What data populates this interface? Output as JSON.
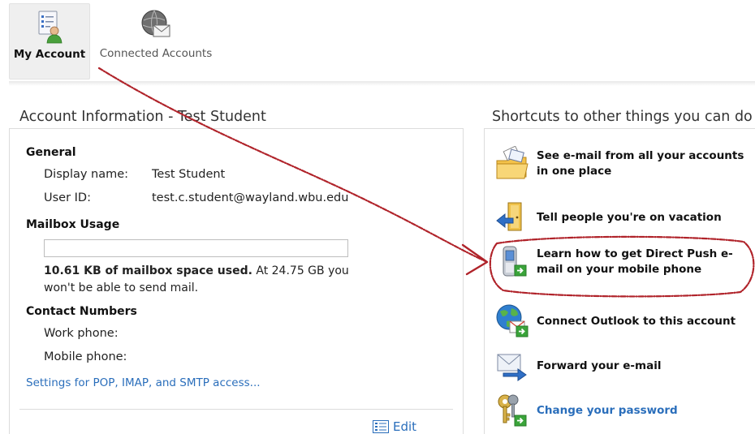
{
  "topnav": {
    "tabs": [
      {
        "label": "My Account",
        "active": true
      },
      {
        "label": "Connected Accounts",
        "active": false
      }
    ]
  },
  "account": {
    "title": "Account Information - Test Student",
    "general": {
      "heading": "General",
      "display_name_label": "Display name:",
      "display_name_value": "Test Student",
      "user_id_label": "User ID:",
      "user_id_value": "test.c.student@wayland.wbu.edu"
    },
    "mailbox": {
      "heading": "Mailbox Usage",
      "used_fraction": 0.0,
      "used_bold": "10.61 KB of mailbox space used.",
      "used_rest": " At 24.75 GB you won't be able to send mail."
    },
    "contact": {
      "heading": "Contact Numbers",
      "work_label": "Work phone:",
      "mobile_label": "Mobile phone:"
    },
    "settings_link": "Settings for POP, IMAP, and SMTP access...",
    "edit_label": "Edit"
  },
  "shortcuts": {
    "title": "Shortcuts to other things you can do",
    "items": [
      {
        "label": "See e-mail from all your accounts in one place",
        "icon": "folder-mail-icon"
      },
      {
        "label": "Tell people you're on vacation",
        "icon": "vacation-door-icon"
      },
      {
        "label": "Learn how to get Direct Push e-mail on your mobile phone",
        "icon": "mobile-phone-icon"
      },
      {
        "label": "Connect Outlook to this account",
        "icon": "outlook-globe-icon"
      },
      {
        "label": "Forward your e-mail",
        "icon": "forward-mail-icon"
      },
      {
        "label": "Change your password",
        "icon": "keys-icon"
      }
    ]
  },
  "colors": {
    "annotation": "#b0232a",
    "link": "#2a6ebb"
  }
}
